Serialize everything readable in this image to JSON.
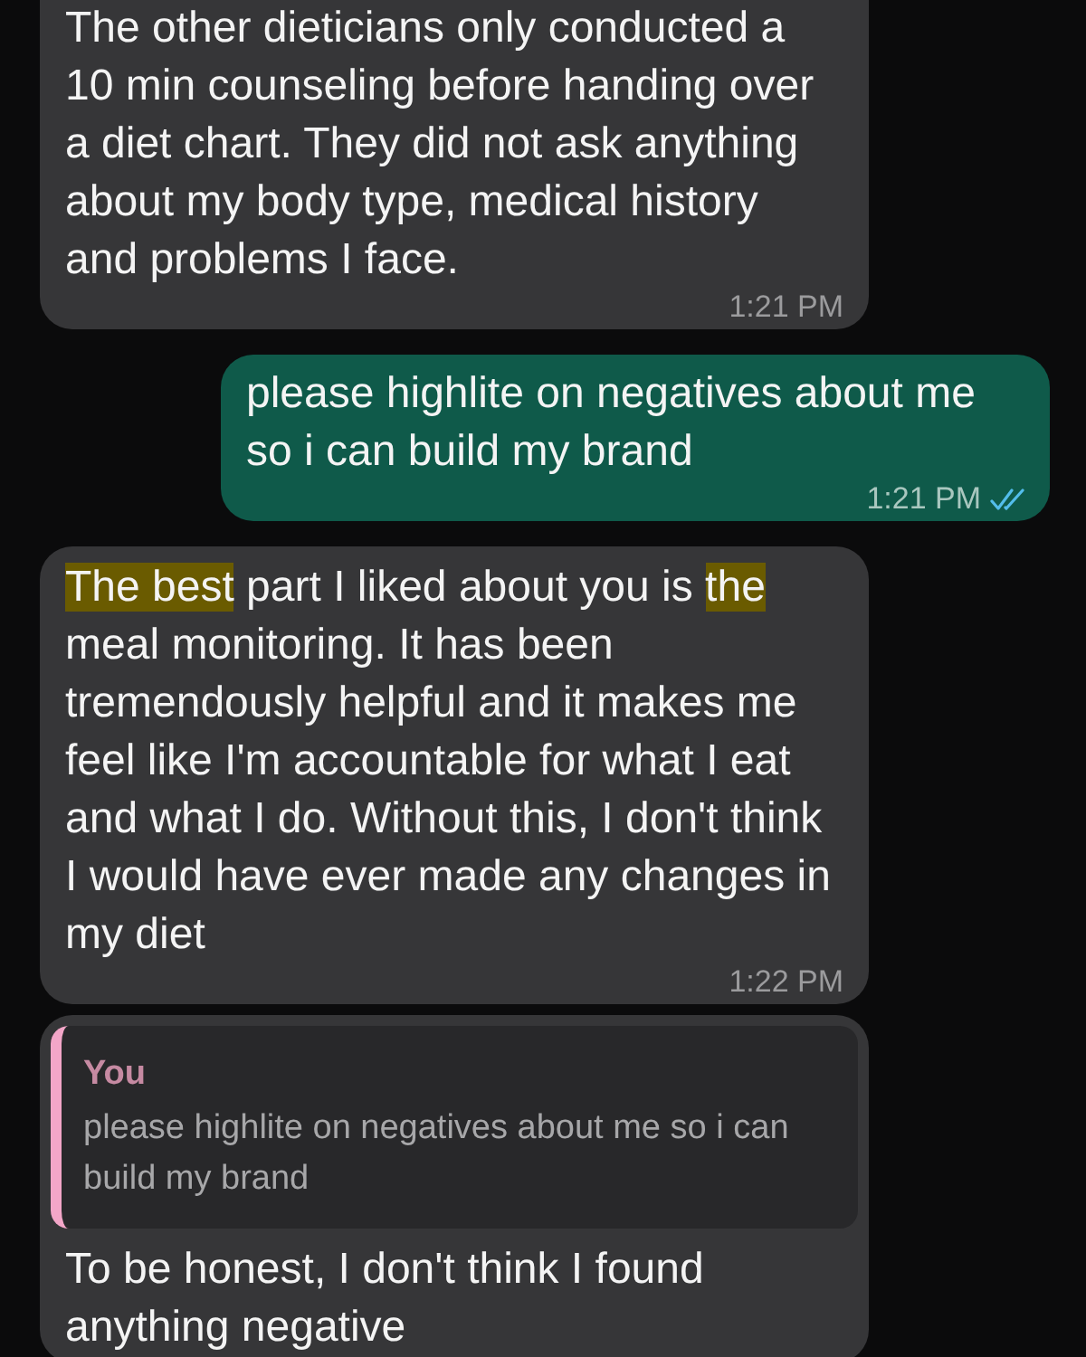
{
  "messages": [
    {
      "kind": "incoming",
      "text": "The other dieticians only conducted a 10 min counseling before handing over a diet chart. They did not ask anything about my body type, medical history and problems I face.",
      "time": "1:21 PM"
    },
    {
      "kind": "outgoing",
      "text": "please highlite on negatives about me so i can build my brand",
      "time": "1:21 PM",
      "read": true
    },
    {
      "kind": "incoming",
      "segments": [
        {
          "text": "The best",
          "highlighted": true
        },
        {
          "text": " part I liked about you is ",
          "highlighted": false
        },
        {
          "text": "the",
          "highlighted": true
        },
        {
          "text": " meal monitoring. It has been tremendously helpful and it makes me feel like I'm accountable for what I eat and what I do. Without this, I don't think I would have ever made any changes in my diet",
          "highlighted": false
        }
      ],
      "time": "1:22 PM"
    },
    {
      "kind": "incoming",
      "reply": {
        "author": "You",
        "text": "please highlite on negatives about me so i can build my brand"
      },
      "text": "To be honest, I don't think I found anything negative"
    }
  ]
}
